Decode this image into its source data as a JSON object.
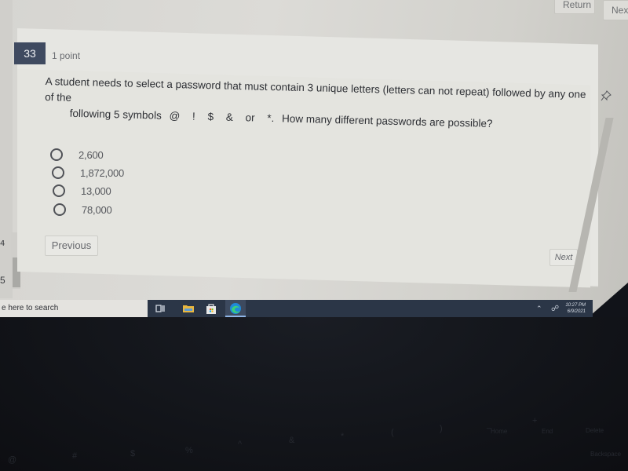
{
  "top_nav": {
    "return_label": "Return",
    "next_label": "Next"
  },
  "question": {
    "number": "33",
    "points": "1 point",
    "text_line1": "A student needs to select a password that must contain 3 unique letters (letters can not repeat) followed by any one of the",
    "text_line2_prefix": "following 5 symbols",
    "symbols": [
      "@",
      "!",
      "$",
      "&",
      "or",
      "*."
    ],
    "text_line2_suffix": "How many different passwords are possible?",
    "pin_icon": "pin-icon",
    "options": [
      {
        "label": "2,600",
        "selected": false
      },
      {
        "label": "1,872,000",
        "selected": false
      },
      {
        "label": "13,000",
        "selected": false
      },
      {
        "label": "78,000",
        "selected": false
      }
    ]
  },
  "navigation": {
    "previous_label": "Previous",
    "next_label": "Next"
  },
  "left_panel": {
    "partial_number_1": "4",
    "partial_number_2": "5"
  },
  "taskbar": {
    "search_placeholder": "e here to search",
    "icons": [
      "task-view-icon",
      "file-explorer-icon",
      "microsoft-store-icon",
      "edge-icon"
    ],
    "tray": {
      "time": "10:27 PM",
      "date": "6/9/2021"
    }
  },
  "keyboard": {
    "visible_keys": [
      "@",
      "#",
      "$",
      "%",
      "^",
      "&",
      "*",
      "(",
      ")",
      "_",
      "+",
      "Home",
      "End",
      "Delete",
      "Backspace"
    ]
  },
  "colors": {
    "question_badge": "#3f4a60",
    "taskbar": "#2b3647",
    "page_background": "#e4e4df"
  }
}
